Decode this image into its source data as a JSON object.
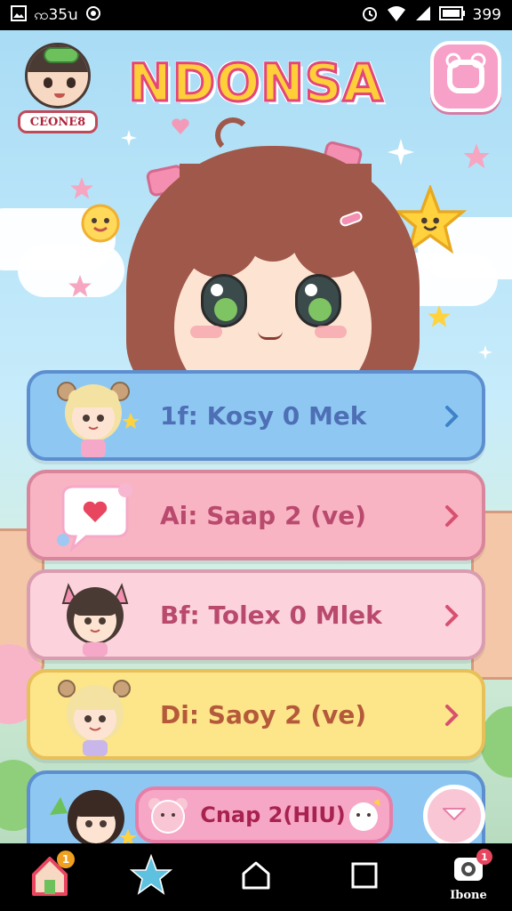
{
  "status_bar": {
    "left_text": "ꩡ35ꭒ",
    "battery": "399"
  },
  "header": {
    "avatar_label": "CEONE8",
    "logo_text": "NDONSA",
    "bag_button": "bag-icon"
  },
  "menu": {
    "items": [
      {
        "label": "1f: Kosy 0 Mek",
        "icon": "bear-girl-icon"
      },
      {
        "label": "Ai: Saap 2 (ve)",
        "icon": "heart-bubble-icon"
      },
      {
        "label": "Bf: Tolex 0 Mlek",
        "icon": "cat-girl-icon"
      },
      {
        "label": "Di: Saoy 2 (ve)",
        "icon": "blonde-girl-icon"
      }
    ],
    "partial_item": {
      "label": "Cnap 2(HIU)"
    }
  },
  "bottom_nav": {
    "items": [
      {
        "name": "home",
        "badge": "1"
      },
      {
        "name": "star-app"
      },
      {
        "name": "system-home"
      },
      {
        "name": "recent-apps"
      },
      {
        "name": "profile",
        "label": "Ibone",
        "badge": "1"
      }
    ]
  },
  "colors": {
    "blue_row": "#8ec8f2",
    "pink_row": "#f9b4c4",
    "light_pink_row": "#fcd3dc",
    "yellow_row": "#fde58a",
    "logo_fill": "#ffcf3a",
    "logo_stroke": "#e2467a"
  }
}
